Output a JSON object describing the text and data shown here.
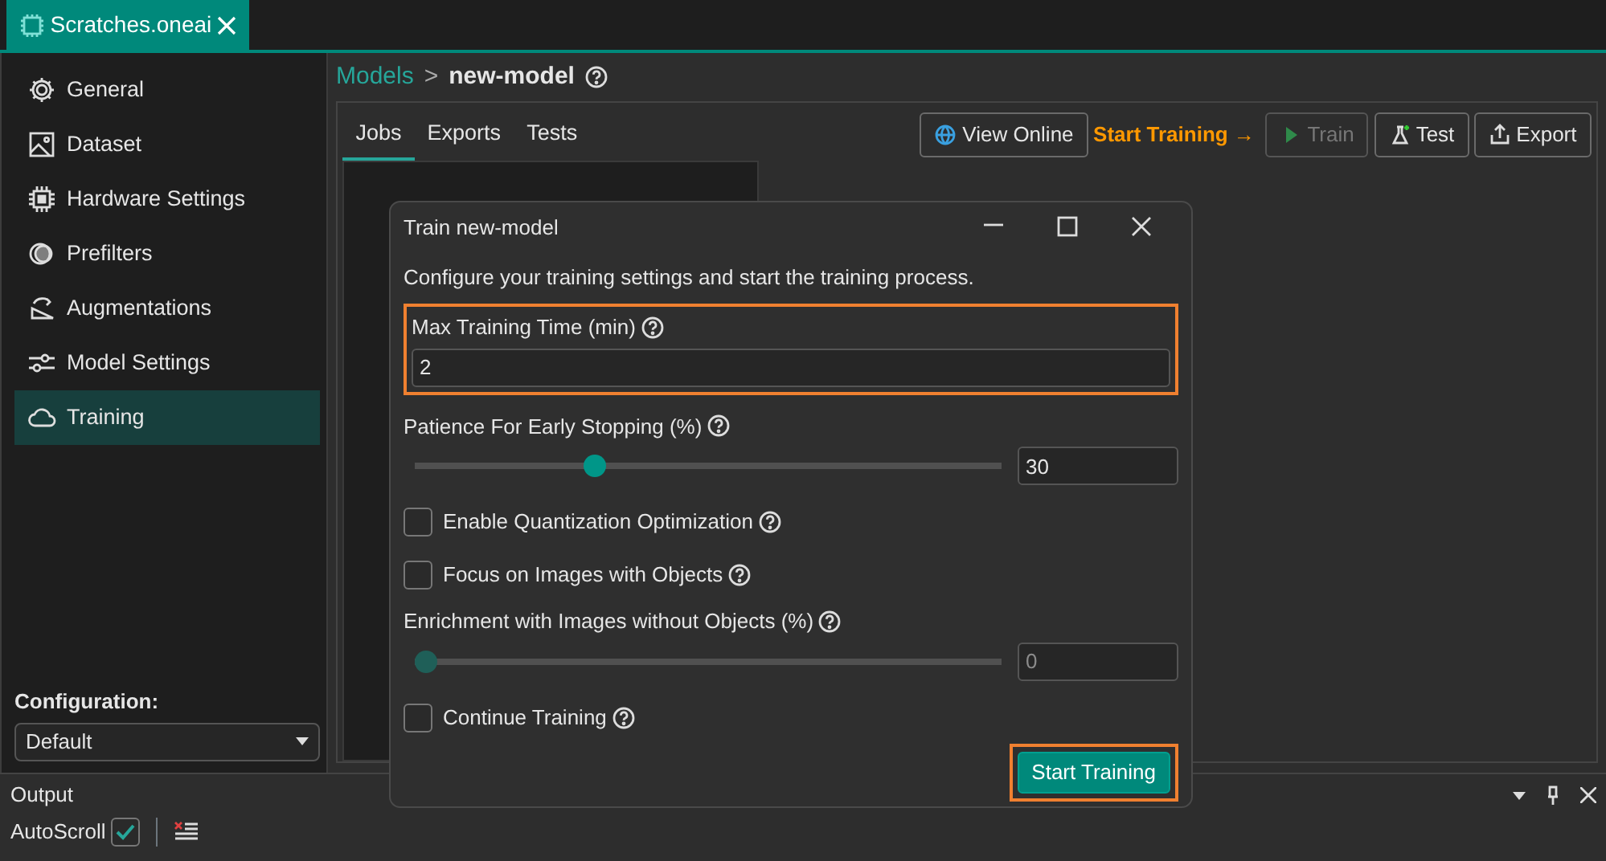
{
  "document_tab": {
    "title": "Scratches.oneai",
    "selected": true
  },
  "sidebar": {
    "items": [
      {
        "label": "General",
        "selected": false
      },
      {
        "label": "Dataset",
        "selected": false
      },
      {
        "label": "Hardware Settings",
        "selected": false
      },
      {
        "label": "Prefilters",
        "selected": false
      },
      {
        "label": "Augmentations",
        "selected": false
      },
      {
        "label": "Model Settings",
        "selected": false
      },
      {
        "label": "Training",
        "selected": true
      }
    ],
    "configuration": {
      "label": "Configuration:",
      "value": "Default"
    }
  },
  "breadcrumb": {
    "root": "Models",
    "separator": ">",
    "current": "new-model"
  },
  "tabs": [
    {
      "label": "Jobs",
      "selected": true
    },
    {
      "label": "Exports",
      "selected": false
    },
    {
      "label": "Tests",
      "selected": false
    }
  ],
  "toolbar": {
    "hint": "Start Training →",
    "buttons": [
      {
        "label": "View Online",
        "disabled": false
      },
      {
        "label": "Train",
        "disabled": true
      },
      {
        "label": "Test",
        "disabled": false
      },
      {
        "label": "Export",
        "disabled": false
      }
    ]
  },
  "dialog": {
    "title": "Train new-model",
    "description": "Configure your training settings and start the training process.",
    "fields": [
      {
        "kind": "number",
        "label": "Max Training Time (min)",
        "value": "2",
        "highlighted": true
      },
      {
        "kind": "slider",
        "label": "Patience For Early Stopping (%)",
        "level": 0.3,
        "value": "30",
        "disabled": false
      },
      {
        "kind": "checkbox",
        "label": "Enable Quantization Optimization",
        "checked": false
      },
      {
        "kind": "checkbox",
        "label": "Focus on Images with Objects",
        "checked": false
      },
      {
        "kind": "slider",
        "label": "Enrichment with Images without Objects (%)",
        "level": 0,
        "value": "0",
        "disabled": true
      },
      {
        "kind": "checkbox",
        "label": "Continue Training",
        "checked": false
      }
    ],
    "button": {
      "label": "Start Training",
      "highlighted": true
    }
  },
  "output": {
    "title": "Output",
    "autoscroll": {
      "label": "AutoScroll",
      "checked": true
    }
  }
}
